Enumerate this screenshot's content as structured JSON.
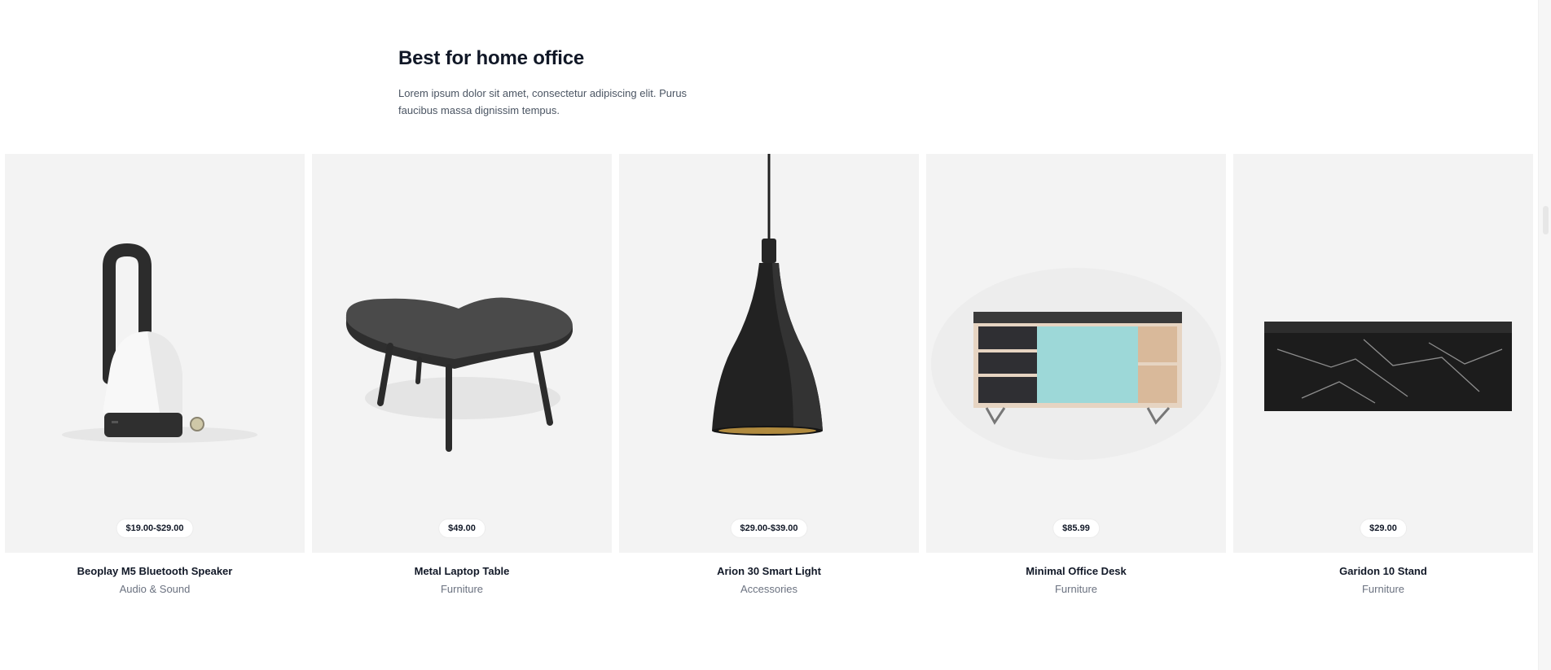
{
  "section": {
    "title": "Best for home office",
    "description": "Lorem ipsum dolor sit amet, consectetur adipiscing elit. Purus faucibus massa dignissim tempus."
  },
  "products": [
    {
      "name": "Beoplay M5 Bluetooth Speaker",
      "category": "Audio & Sound",
      "price": "$19.00-$29.00",
      "image": "lantern-speaker"
    },
    {
      "name": "Metal Laptop Table",
      "category": "Furniture",
      "price": "$49.00",
      "image": "low-table"
    },
    {
      "name": "Arion 30 Smart Light",
      "category": "Accessories",
      "price": "$29.00-$39.00",
      "image": "pendant-lamp"
    },
    {
      "name": "Minimal Office Desk",
      "category": "Furniture",
      "price": "$85.99",
      "image": "sideboard"
    },
    {
      "name": "Garidon 10 Stand",
      "category": "Furniture",
      "price": "$29.00",
      "image": "marble-block"
    }
  ],
  "colors": {
    "card_bg": "#f3f3f3",
    "title": "#111827",
    "muted": "#6b7280",
    "sideboard_door": "#9dd8d8"
  }
}
